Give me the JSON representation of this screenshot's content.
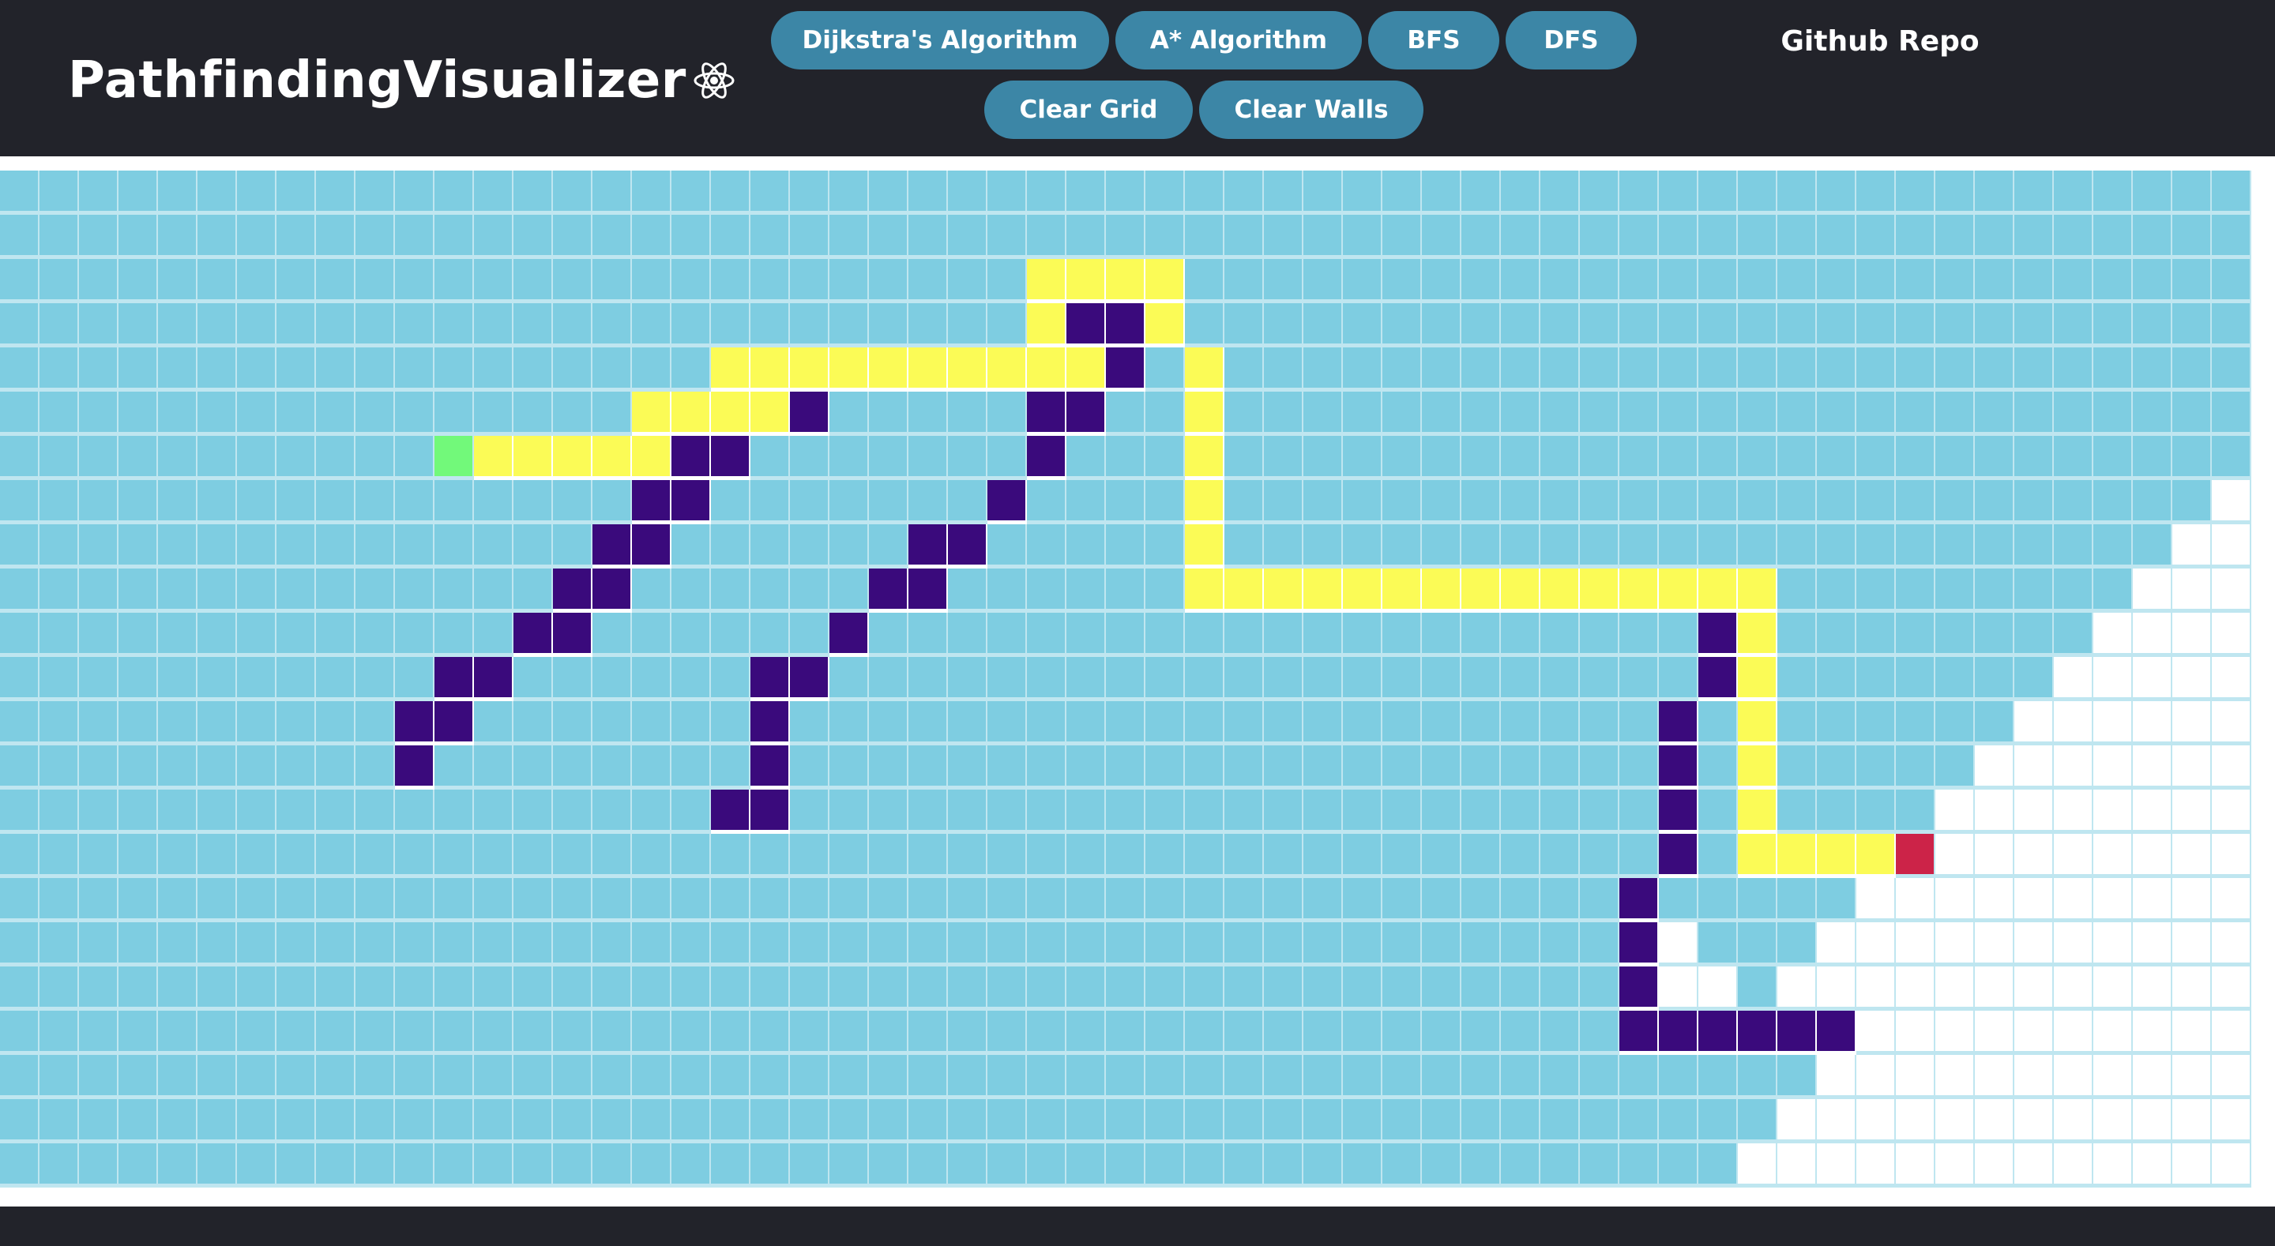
{
  "navbar": {
    "brand_title": "PathfindingVisualizer",
    "brand_logo_icon": "react-atom-icon",
    "algorithm_buttons": [
      {
        "label": "Dijkstra's Algorithm"
      },
      {
        "label": "A* Algorithm"
      },
      {
        "label": "BFS"
      },
      {
        "label": "DFS"
      }
    ],
    "clear_grid_label": "Clear Grid",
    "clear_walls_label": "Clear Walls",
    "repo_link_label": "Github Repo"
  },
  "colors": {
    "navbar_bg": "#22232a",
    "button_bg": "#3c86a6",
    "visited": "#7ecde1",
    "unvisited": "#ffffff",
    "wall": "#3a0a7c",
    "path": "#fbfb56",
    "start": "#72f97a",
    "finish": "#cc2348"
  },
  "grid": {
    "rows": 23,
    "cols": 57,
    "legend": {
      "v": "visited",
      "u": "unvisited",
      "w": "wall",
      "p": "path",
      "s": "start",
      "f": "finish"
    },
    "map": [
      "vvvvvvvvvvvvvvvvvvvvvvvvvvvvvvvvvvvvvvvvvvvvvvvvvvvvvvvvv",
      "vvvvvvvvvvvvvvvvvvvvvvvvvvvvvvvvvvvvvvvvvvvvvvvvvvvvvvvvv",
      "vvvvvvvvvvvvvvvvvvvvvvvvvvppppvvvvvvvvvvvvvvvvvvvvvvvvvvv",
      "vvvvvvvvvvvvvvvvvvvvvvvvvvpwwpvvvvvvvvvvvvvvvvvvvvvvvvvvv",
      "vvvvvvvvvvvvvvvvvvppppppppppwvpvvvvvvvvvvvvvvvvvvvvvvvvvv",
      "vvvvvvvvvvvvvvvvppppwvvvvvwwvvpvvvvvvvvvvvvvvvvvvvvvvvvvv",
      "vvvvvvvvvvvspppppwwvvvvvvvwvvvpvvvvvvvvvvvvvvvvvvvvvvvvvv",
      "vvvvvvvvvvvvvvvvwwvvvvvvvwvvvvpvvvvvvvvvvvvvvvvvvvvvvvvvu",
      "vvvvvvvvvvvvvvvwwvvvvvvwwvvvvvpvvvvvvvvvvvvvvvvvvvvvvvvuu",
      "vvvvvvvvvvvvvvwwvvvvvvwwvvvvvvpppppppppppppppvvvvvvvvvuuu",
      "vvvvvvvvvvvvvwwvvvvvvwvvvvvvvvvvvvvvvvvvvvvwpvvvvvvvvuuuu",
      "vvvvvvvvvvvwwvvvvvvwwvvvvvvvvvvvvvvvvvvvvvvwpvvvvvvvuuuuu",
      "vvvvvvvvvvwwvvvvvvvwvvvvvvvvvvvvvvvvvvvvvvwvpvvvvvvuuuuuu",
      "vvvvvvvvvvwvvvvvvvvwvvvvvvvvvvvvvvvvvvvvvvwvpvvvvvuuuuuuu",
      "vvvvvvvvvvvvvvvvvvwwvvvvvvvvvvvvvvvvvvvvvvwvpvvvvuuuuuuuu",
      "vvvvvvvvvvvvvvvvvvvvvvvvvvvvvvvvvvvvvvvvvvwvppppfuuuuuuuu",
      "vvvvvvvvvvvvvvvvvvvvvvvvvvvvvvvvvvvvvvvvvwvvvvvuuuuuuuuuu",
      "vvvvvvvvvvvvvvvvvvvvvvvvvvvvvvvvvvvvvvvvvwuvvvuuuuuuuuuuu",
      "vvvvvvvvvvvvvvvvvvvvvvvvvvvvvvvvvvvvvvvvvwuuvuuuuuuuuuuuu",
      "vvvvvvvvvvvvvvvvvvvvvvvvvvvvvvvvvvvvvvvvvwwwwwwuuuuuuuuuu",
      "vvvvvvvvvvvvvvvvvvvvvvvvvvvvvvvvvvvvvvvvvvvvvvuuuuuuuuuuu",
      "vvvvvvvvvvvvvvvvvvvvvvvvvvvvvvvvvvvvvvvvvvvvvuuuuuuuuuuuu",
      "vvvvvvvvvvvvvvvvvvvvvvvvvvvvvvvvvvvvvvvvvvvvuuuuuuuuuuuuu"
    ]
  }
}
